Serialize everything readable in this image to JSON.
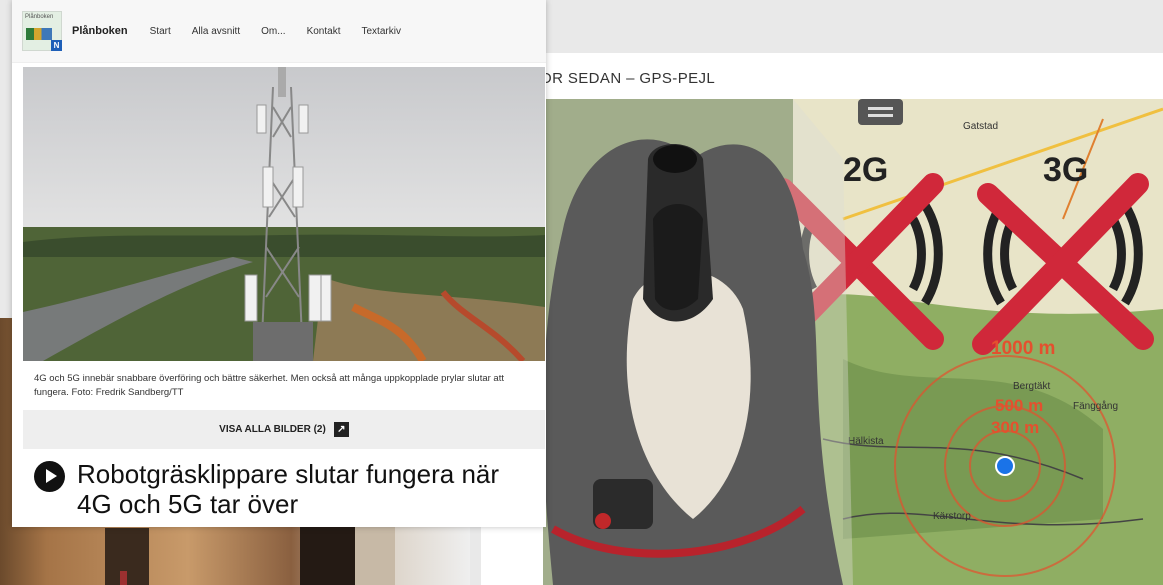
{
  "site": {
    "brand": "Plånboken",
    "logo_badge": "N"
  },
  "nav": {
    "items": [
      "Start",
      "Alla avsnitt",
      "Om...",
      "Kontakt",
      "Textarkiv"
    ]
  },
  "article": {
    "caption": "4G och 5G innebär snabbare överföring och bättre säkerhet. Men också att många uppkopplade prylar slutar att fungera. Foto: Fredrik Sandberg/TT",
    "view_all_label": "VISA ALLA BILDER (2)",
    "headline": "Robotgräsklippare slutar fungera när 4G och 5G tar över"
  },
  "background_article": {
    "kicker": "OR SEDAN – GPS-PEJL",
    "image_labels": {
      "net_2g": "2G",
      "net_3g": "3G",
      "dist_1000": "1000 m",
      "dist_500": "500 m",
      "dist_300": "300 m",
      "map_places": [
        "Gatstad",
        "Bergtäkt",
        "Fänggång",
        "Hälkista",
        "Kärstorp"
      ]
    }
  },
  "colors": {
    "cross": "#d0283a",
    "range": "#e4502e",
    "map_green": "#7d9a5a",
    "gps_dot": "#1a73e8"
  }
}
